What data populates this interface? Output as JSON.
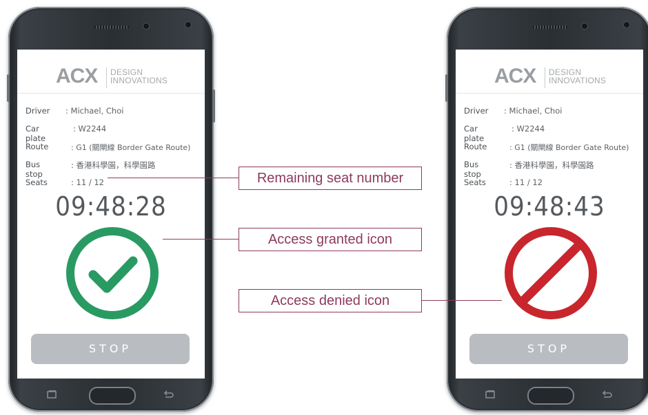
{
  "phones": [
    {
      "logo": {
        "mark": "ACX",
        "line1": "DESIGN",
        "line2": "INNOVATIONS"
      },
      "info": [
        {
          "label": "Driver",
          "value": ": Michael, Choi"
        },
        {
          "label": "Car plate",
          "value": ": W2244"
        },
        {
          "label": "Route",
          "value": ": G1 (關閘線 Border Gate Route)"
        },
        {
          "label": "Bus stop",
          "value": ": 香港科學園，科學園路"
        },
        {
          "label": "Seats",
          "value": ": 11 / 12"
        }
      ],
      "clock": "09:48:28",
      "status": "access-granted",
      "stop_label": "STOP"
    },
    {
      "logo": {
        "mark": "ACX",
        "line1": "DESIGN",
        "line2": "INNOVATIONS"
      },
      "info": [
        {
          "label": "Driver",
          "value": ": Michael, Choi"
        },
        {
          "label": "Car plate",
          "value": ": W2244"
        },
        {
          "label": "Route",
          "value": ": G1 (關閘線 Border Gate Route)"
        },
        {
          "label": "Bus stop",
          "value": ": 香港科學園，科學園路"
        },
        {
          "label": "Seats",
          "value": ": 11 / 12"
        }
      ],
      "clock": "09:48:43",
      "status": "access-denied",
      "stop_label": "STOP"
    }
  ],
  "callouts": {
    "seats": "Remaining seat number",
    "granted": "Access granted icon",
    "denied": "Access denied icon"
  },
  "colors": {
    "granted": "#2a9a63",
    "denied": "#c8262c",
    "callout": "#8c3a5c",
    "stop_button": "#b9bdc2"
  }
}
